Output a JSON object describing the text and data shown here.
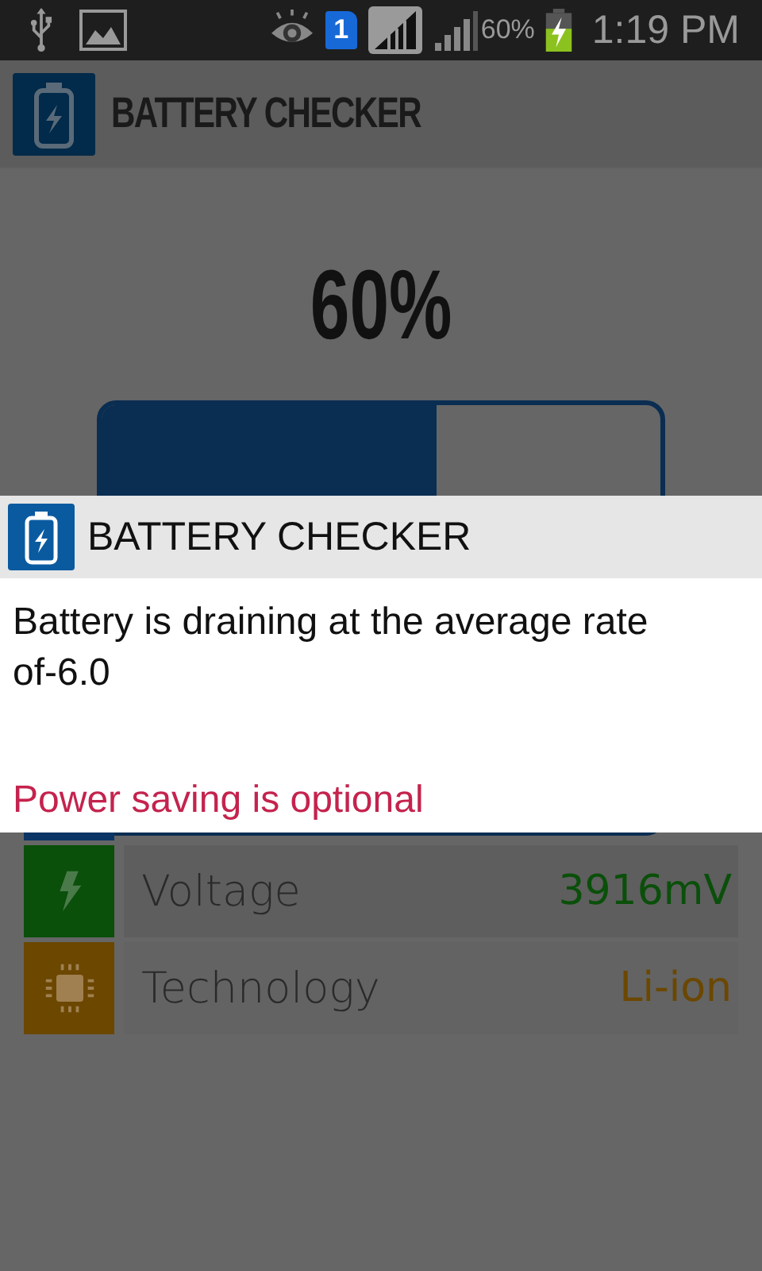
{
  "status_bar": {
    "sim_slot": "1",
    "battery_percent": "60%",
    "time": "1:19 PM"
  },
  "app_bar": {
    "title": "BATTERY CHECKER"
  },
  "battery": {
    "percent": "60%",
    "level": 0.6
  },
  "rows": [
    {
      "label": "Voltage",
      "value": "3916mV",
      "color": "#0a4f0a",
      "kind": "voltage"
    },
    {
      "label": "Technology",
      "value": "Li-ion",
      "color": "#6b4700",
      "kind": "technology"
    }
  ],
  "dialog": {
    "title": "BATTERY CHECKER",
    "message": "Battery is draining at the average rate of-6.0",
    "note": "Power saving is optional"
  }
}
